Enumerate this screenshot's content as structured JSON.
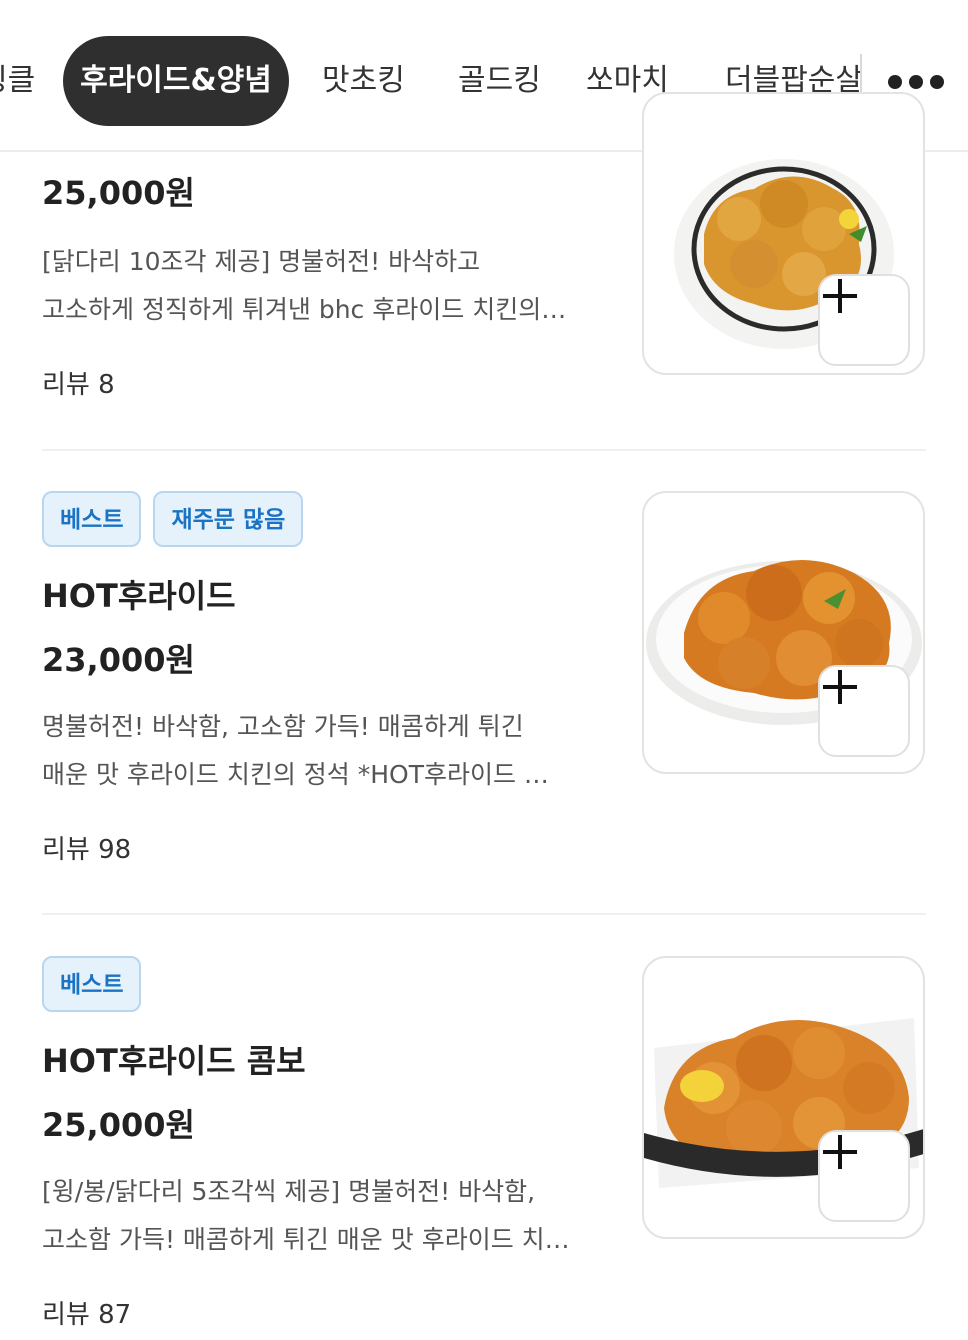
{
  "tabs": [
    {
      "label": "링클"
    },
    {
      "label": "후라이드&양념"
    },
    {
      "label": "맛초킹"
    },
    {
      "label": "골드킹"
    },
    {
      "label": "쏘마치"
    },
    {
      "label": "더블팝순살"
    }
  ],
  "more_icon": "more-horizontal-icon",
  "add_icon": "plus-icon",
  "colors": {
    "active_tab_bg": "#2f2f2f",
    "badge_bg": "#e5f1fb",
    "badge_text": "#1a73c4"
  },
  "items": [
    {
      "price": "25,000원",
      "desc_line1": "[닭다리 10조각 제공] 명불허전! 바삭하고",
      "desc_line2": "고소하게 정직하게 튀겨낸 bhc 후라이드 치킨의…",
      "review": "리뷰 8"
    },
    {
      "badges": [
        "베스트",
        "재주문 많음"
      ],
      "name": "HOT후라이드",
      "price": "23,000원",
      "desc_line1": "명불허전! 바삭함, 고소함 가득! 매콤하게 튀긴",
      "desc_line2": "매운 맛 후라이드 치킨의 정석 *HOT후라이드 …",
      "review": "리뷰 98"
    },
    {
      "badges": [
        "베스트"
      ],
      "name": "HOT후라이드 콤보",
      "price": "25,000원",
      "desc_line1": "[윙/봉/닭다리 5조각씩 제공] 명불허전! 바삭함,",
      "desc_line2": "고소함 가득! 매콤하게 튀긴 매운 맛 후라이드 치…",
      "review": "리뷰 87"
    }
  ]
}
